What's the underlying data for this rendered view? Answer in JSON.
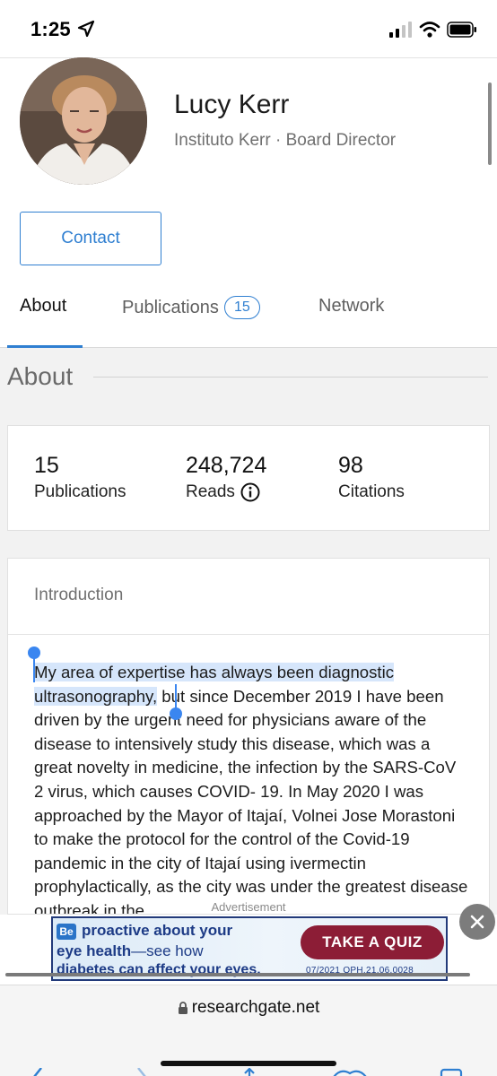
{
  "status_bar": {
    "time": "1:25",
    "icons": [
      "location-arrow-icon",
      "cellular-signal-icon",
      "wifi-icon",
      "battery-icon"
    ]
  },
  "profile": {
    "name": "Lucy Kerr",
    "affiliation": "Instituto Kerr · Board Director",
    "contact_label": "Contact"
  },
  "tabs": [
    {
      "label": "About",
      "active": true
    },
    {
      "label": "Publications",
      "badge": "15"
    },
    {
      "label": "Network"
    }
  ],
  "about": {
    "title": "About",
    "stats": [
      {
        "value": "15",
        "label": "Publications"
      },
      {
        "value": "248,724",
        "label": "Reads"
      },
      {
        "value": "98",
        "label": "Citations"
      }
    ],
    "introduction": {
      "heading": "Introduction",
      "selected_text": "My area of expertise has always been diagnostic ultrasonography,",
      "body_text": " but since December 2019 I have been driven by the urgent need for physicians aware of the disease to intensively study this disease, which was a great novelty in medicine, the infection by the SARS-CoV 2 virus, which causes COVID- 19. In May 2020 I was approached by the Mayor of Itajaí, Volnei Jose Morastoni to make the protocol for the control of the Covid-19 pandemic in the city of Itajaí using ivermectin prophylactically, as the city was under the greatest disease outbreak in the"
    }
  },
  "advertisement": {
    "label": "Advertisement",
    "line1": "proactive about your",
    "line2_bold": "eye health",
    "line2_rest": "—see how",
    "line3": "diabetes can affect your eyes.",
    "code": "07/2021   OPH.21.06.0028",
    "cta": "TAKE A QUIZ",
    "logo": "Be"
  },
  "browser": {
    "url": "researchgate.net"
  },
  "colors": {
    "accent": "#2f7fd1",
    "selection": "#d6e6fb",
    "ad_cta": "#8c1d36",
    "ad_text": "#1d3b86"
  }
}
